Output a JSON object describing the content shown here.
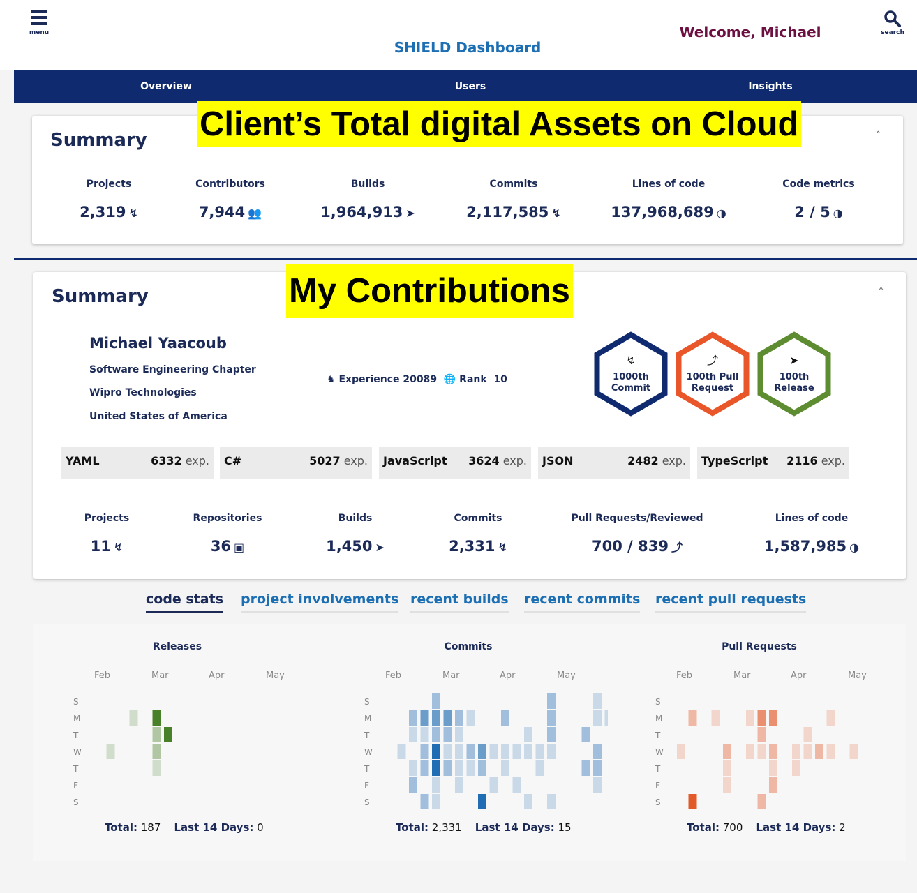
{
  "header": {
    "menu_label": "menu",
    "title": "SHIELD Dashboard",
    "welcome": "Welcome, Michael",
    "search_label": "search"
  },
  "nav": [
    "Overview",
    "Users",
    "Insights"
  ],
  "org_summary": {
    "title": "Summary",
    "callout": "Client’s Total digital Assets on Cloud",
    "stats": [
      {
        "label": "Projects",
        "value": "2,319",
        "icon": "project-tree-icon"
      },
      {
        "label": "Contributors",
        "value": "7,944",
        "icon": "users-icon"
      },
      {
        "label": "Builds",
        "value": "1,964,913",
        "icon": "rocket-icon"
      },
      {
        "label": "Commits",
        "value": "2,117,585",
        "icon": "commit-tree-icon"
      },
      {
        "label": "Lines of code",
        "value": "137,968,689",
        "icon": "shield-icon"
      },
      {
        "label": "Code metrics",
        "value": "2 / 5",
        "icon": "shield-icon"
      }
    ]
  },
  "my_summary": {
    "title": "Summary",
    "callout": "My Contributions",
    "name": "Michael Yaacoub",
    "chapter": "Software Engineering Chapter",
    "company": "Wipro Technologies",
    "country": "United States of America",
    "experience_label": "Experience",
    "experience": "20089",
    "rank_label": "Rank",
    "rank": "10",
    "badges": [
      {
        "line1": "1000th",
        "line2": "Commit",
        "color": "#0f2a6e",
        "icon": "commit-tree-icon"
      },
      {
        "line1": "100th Pull",
        "line2": "Request",
        "color": "#e8562a",
        "icon": "merge-icon"
      },
      {
        "line1": "100th",
        "line2": "Release",
        "color": "#5e8c31",
        "icon": "rocket-icon"
      }
    ],
    "languages": [
      {
        "name": "YAML",
        "exp": "6332",
        "unit": "exp."
      },
      {
        "name": "C#",
        "exp": "5027",
        "unit": "exp."
      },
      {
        "name": "JavaScript",
        "exp": "3624",
        "unit": "exp."
      },
      {
        "name": "JSON",
        "exp": "2482",
        "unit": "exp."
      },
      {
        "name": "TypeScript",
        "exp": "2116",
        "unit": "exp."
      }
    ],
    "stats": [
      {
        "label": "Projects",
        "value": "11",
        "icon": "project-tree-icon"
      },
      {
        "label": "Repositories",
        "value": "36",
        "icon": "repo-icon"
      },
      {
        "label": "Builds",
        "value": "1,450",
        "icon": "rocket-icon"
      },
      {
        "label": "Commits",
        "value": "2,331",
        "icon": "commit-tree-icon"
      },
      {
        "label": "Pull Requests/Reviewed",
        "value": "700 / 839",
        "icon": "merge-icon"
      },
      {
        "label": "Lines of code",
        "value": "1,587,985",
        "icon": "shield-icon"
      }
    ]
  },
  "tabs": [
    "code stats",
    "project involvements",
    "recent builds",
    "recent commits",
    "recent pull requests"
  ],
  "chart_data": [
    {
      "type": "heatmap",
      "title": "Releases",
      "months": [
        "Feb",
        "Mar",
        "Apr",
        "May"
      ],
      "days": [
        "S",
        "M",
        "T",
        "W",
        "T",
        "F",
        "S"
      ],
      "color": "#3e7a1e",
      "cells": [
        [
          3,
          1,
          1
        ],
        [
          5,
          1,
          4
        ],
        [
          5,
          2,
          2
        ],
        [
          5,
          3,
          2
        ],
        [
          5,
          4,
          1
        ],
        [
          6,
          2,
          4
        ],
        [
          1,
          3,
          1
        ]
      ],
      "total_label": "Total:",
      "total": "187",
      "last14_label": "Last 14 Days:",
      "last14": "0"
    },
    {
      "type": "heatmap",
      "title": "Commits",
      "months": [
        "Feb",
        "Mar",
        "Apr",
        "May"
      ],
      "days": [
        "S",
        "M",
        "T",
        "W",
        "T",
        "F",
        "S"
      ],
      "color": "#1565b0",
      "cells": [
        [
          1,
          3,
          1
        ],
        [
          2,
          1,
          2
        ],
        [
          2,
          2,
          1
        ],
        [
          2,
          4,
          1
        ],
        [
          2,
          5,
          2
        ],
        [
          3,
          1,
          3
        ],
        [
          3,
          2,
          1
        ],
        [
          3,
          3,
          2
        ],
        [
          3,
          4,
          2
        ],
        [
          3,
          6,
          2
        ],
        [
          4,
          0,
          2
        ],
        [
          4,
          1,
          3
        ],
        [
          4,
          2,
          2
        ],
        [
          4,
          3,
          4
        ],
        [
          4,
          4,
          4
        ],
        [
          4,
          5,
          1
        ],
        [
          4,
          6,
          1
        ],
        [
          5,
          1,
          3
        ],
        [
          5,
          2,
          2
        ],
        [
          5,
          3,
          1
        ],
        [
          5,
          4,
          2
        ],
        [
          6,
          1,
          2
        ],
        [
          6,
          2,
          1
        ],
        [
          6,
          3,
          1
        ],
        [
          6,
          4,
          1
        ],
        [
          6,
          5,
          1
        ],
        [
          7,
          1,
          1
        ],
        [
          7,
          3,
          2
        ],
        [
          7,
          4,
          1
        ],
        [
          8,
          3,
          3
        ],
        [
          8,
          4,
          2
        ],
        [
          8,
          6,
          4
        ],
        [
          9,
          3,
          1
        ],
        [
          9,
          5,
          1
        ],
        [
          10,
          1,
          2
        ],
        [
          10,
          3,
          1
        ],
        [
          10,
          4,
          1
        ],
        [
          11,
          3,
          1
        ],
        [
          11,
          5,
          1
        ],
        [
          12,
          2,
          1
        ],
        [
          12,
          3,
          1
        ],
        [
          12,
          6,
          1
        ],
        [
          13,
          3,
          1
        ],
        [
          13,
          4,
          1
        ],
        [
          14,
          0,
          2
        ],
        [
          14,
          1,
          2
        ],
        [
          14,
          2,
          2
        ],
        [
          14,
          3,
          1
        ],
        [
          14,
          6,
          1
        ],
        [
          17,
          2,
          2
        ],
        [
          17,
          4,
          2
        ],
        [
          18,
          0,
          1
        ],
        [
          18,
          1,
          1
        ],
        [
          18,
          3,
          2
        ],
        [
          18,
          4,
          2
        ],
        [
          18,
          5,
          1
        ],
        [
          19,
          1,
          1
        ]
      ],
      "total_label": "Total:",
      "total": "2,331",
      "last14_label": "Last 14 Days:",
      "last14": "15"
    },
    {
      "type": "heatmap",
      "title": "Pull Requests",
      "months": [
        "Feb",
        "Mar",
        "Apr",
        "May"
      ],
      "days": [
        "S",
        "M",
        "T",
        "W",
        "T",
        "F",
        "S"
      ],
      "color": "#e2511f",
      "cells": [
        [
          0,
          3,
          1
        ],
        [
          1,
          1,
          2
        ],
        [
          1,
          6,
          4
        ],
        [
          3,
          1,
          1
        ],
        [
          4,
          3,
          2
        ],
        [
          4,
          4,
          1
        ],
        [
          4,
          5,
          1
        ],
        [
          6,
          1,
          1
        ],
        [
          6,
          3,
          1
        ],
        [
          7,
          1,
          3
        ],
        [
          7,
          2,
          2
        ],
        [
          7,
          3,
          1
        ],
        [
          7,
          6,
          2
        ],
        [
          8,
          1,
          3
        ],
        [
          8,
          3,
          2
        ],
        [
          8,
          4,
          1
        ],
        [
          8,
          5,
          2
        ],
        [
          10,
          3,
          1
        ],
        [
          10,
          4,
          1
        ],
        [
          11,
          3,
          1
        ],
        [
          11,
          2,
          1
        ],
        [
          12,
          3,
          2
        ],
        [
          13,
          1,
          1
        ],
        [
          13,
          3,
          1
        ],
        [
          15,
          3,
          1
        ]
      ],
      "total_label": "Total:",
      "total": "700",
      "last14_label": "Last 14 Days:",
      "last14": "2"
    }
  ]
}
